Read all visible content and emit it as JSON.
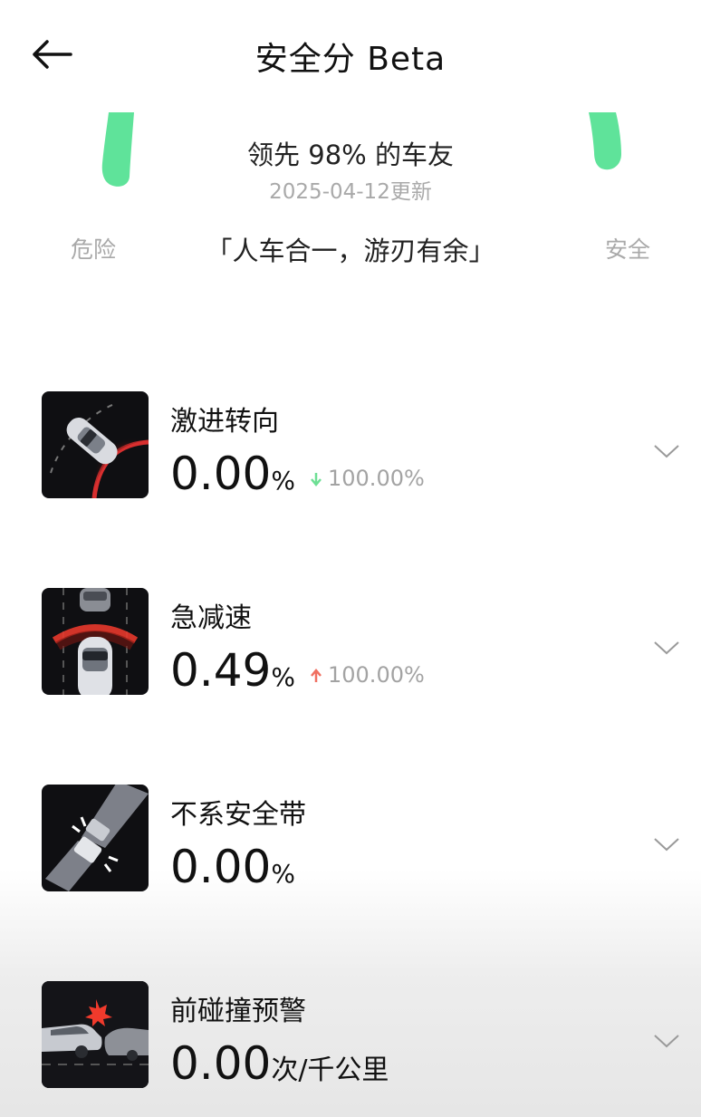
{
  "header": {
    "title": "安全分 Beta"
  },
  "score": {
    "lead_text": "领先 98% 的车友",
    "updated": "2025-04-12更新",
    "left_label": "危险",
    "right_label": "安全",
    "motto": "「人车合一，游刃有余」",
    "colors": {
      "accent": "#5fe39a",
      "down": "#6ddf94",
      "up": "#f06f60"
    }
  },
  "items": [
    {
      "title": "激进转向",
      "value": "0.00",
      "unit": "%",
      "trend_dir": "down",
      "trend": "100.00%",
      "icon": "aggressive-turn-car-icon"
    },
    {
      "title": "急减速",
      "value": "0.49",
      "unit": "%",
      "trend_dir": "up",
      "trend": "100.00%",
      "icon": "hard-braking-car-icon"
    },
    {
      "title": "不系安全带",
      "value": "0.00",
      "unit": "%",
      "icon": "seatbelt-icon"
    },
    {
      "title": "前碰撞预警",
      "value": "0.00",
      "unit": "次/千公里",
      "icon": "forward-collision-icon"
    }
  ]
}
